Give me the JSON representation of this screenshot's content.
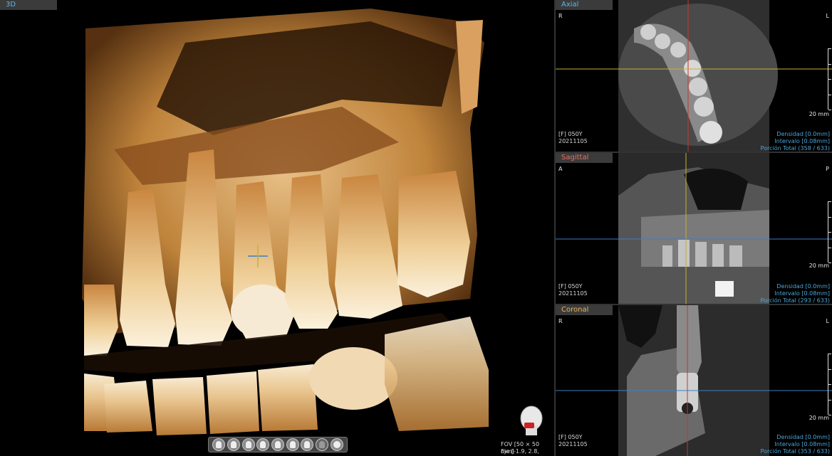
{
  "panels": {
    "view3d": {
      "title": "3D",
      "fov_label": "FOV [50 × 50 mm]",
      "axis_label": "Eje [-1.9, 2.8, -3.3]",
      "toolbar_icons": [
        "head-front-icon",
        "head-left-icon",
        "head-right-icon",
        "head-back-icon",
        "head-top-icon",
        "head-bottom-icon",
        "head-oblique-icon",
        "head-gray-icon",
        "rotate-icon"
      ]
    },
    "axial": {
      "title": "Axial",
      "orient_left": "R",
      "orient_right": "L",
      "patient_line1": "[F] 050Y",
      "patient_line2": "20211105",
      "scale": "20 mm",
      "density": "Densidad [0.0mm]",
      "interval": "Intervalo [0.08mm]",
      "portion": "Porción Total (358 / 633)"
    },
    "sagittal": {
      "title": "Sagittal",
      "orient_left": "A",
      "orient_right": "P",
      "patient_line1": "[F] 050Y",
      "patient_line2": "20211105",
      "scale": "20 mm",
      "density": "Densidad [0.0mm]",
      "interval": "Intervalo [0.08mm]",
      "portion": "Porción Total (293 / 633)"
    },
    "coronal": {
      "title": "Coronal",
      "orient_left": "R",
      "orient_right": "L",
      "patient_line1": "[F] 050Y",
      "patient_line2": "20211105",
      "scale": "20 mm",
      "density": "Densidad [0.0mm]",
      "interval": "Intervalo [0.08mm]",
      "portion": "Porción Total (353 / 633)"
    }
  },
  "colors": {
    "tab_text": "#5fb4e8",
    "sagittal_tab_text": "#e8705f",
    "coronal_tab_text": "#e8b25f",
    "crosshair_red": "#c0392b",
    "crosshair_blue": "#3a7fc4",
    "crosshair_yellow": "#c8b030"
  }
}
